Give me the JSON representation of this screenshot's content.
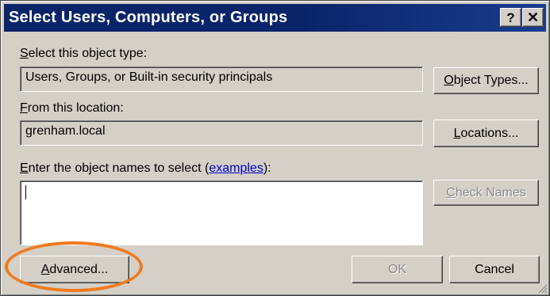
{
  "window": {
    "title": "Select Users, Computers, or Groups",
    "help_glyph": "?",
    "close_glyph": "✕"
  },
  "object_type": {
    "label_prefix": "S",
    "label_rest": "elect this object type:",
    "value": "Users, Groups, or Built-in security principals",
    "button_prefix": "O",
    "button_rest": "bject Types..."
  },
  "location": {
    "label_prefix": "F",
    "label_rest": "rom this location:",
    "value": "grenham.local",
    "button_prefix": "L",
    "button_rest": "ocations..."
  },
  "names": {
    "label_prefix": "E",
    "label_mid": "nter the object names to select (",
    "link_text": "examples",
    "label_suffix": "):",
    "value": "",
    "check_prefix": "C",
    "check_rest": "heck Names"
  },
  "footer": {
    "advanced_prefix": "A",
    "advanced_rest": "dvanced...",
    "ok_label": "OK",
    "cancel_label": "Cancel"
  },
  "highlight": {
    "color": "#f07a1e"
  },
  "colors": {
    "title_bar": "#0a246a",
    "dialog_bg": "#d4d0c8",
    "link": "#0000cc"
  }
}
